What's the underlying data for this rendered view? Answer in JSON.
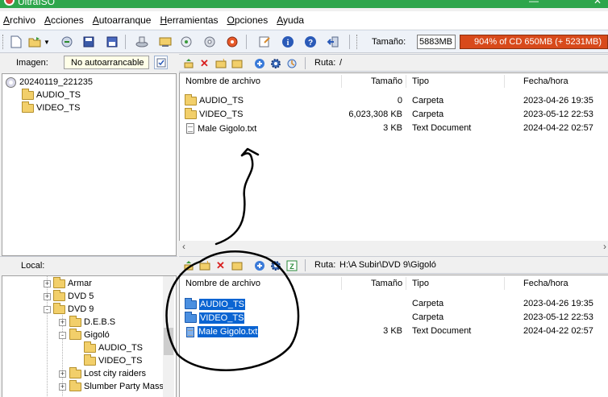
{
  "app": {
    "title": "UltraISO"
  },
  "menu": [
    "Archivo",
    "Acciones",
    "Autoarranque",
    "Herramientas",
    "Opciones",
    "Ayuda"
  ],
  "toolbar": {
    "size_label": "Tamaño:",
    "size_value": "5883MB",
    "capacity_text": "904% of CD 650MB (+ 5231MB)",
    "capacity_percent": 904
  },
  "image_pane": {
    "label": "Imagen:",
    "boot_status": "No autoarrancable",
    "tree": [
      {
        "label": "20240119_221235",
        "type": "disc"
      },
      {
        "label": "AUDIO_TS",
        "type": "folder"
      },
      {
        "label": "VIDEO_TS",
        "type": "folder"
      }
    ]
  },
  "upper_files": {
    "path_label": "Ruta:",
    "path": "/",
    "columns": [
      "Nombre de archivo",
      "Tamaño",
      "Tipo",
      "Fecha/hora"
    ],
    "rows": [
      {
        "name": "AUDIO_TS",
        "size": "0",
        "type": "Carpeta",
        "date": "2023-04-26 19:35",
        "icon": "folder"
      },
      {
        "name": "VIDEO_TS",
        "size": "6,023,308 KB",
        "type": "Carpeta",
        "date": "2023-05-12 22:53",
        "icon": "folder"
      },
      {
        "name": "Male Gigolo.txt",
        "size": "3 KB",
        "type": "Text Document",
        "date": "2024-04-22 02:57",
        "icon": "doc"
      }
    ]
  },
  "local_pane": {
    "label": "Local:",
    "tree": [
      {
        "label": "Armar",
        "expander": "+"
      },
      {
        "label": "DVD 5",
        "expander": "+"
      },
      {
        "label": "DVD 9",
        "expander": "-"
      },
      {
        "label": "D.E.B.S",
        "expander": "+"
      },
      {
        "label": "Gigoló",
        "expander": "-"
      },
      {
        "label": "AUDIO_TS",
        "expander": ""
      },
      {
        "label": "VIDEO_TS",
        "expander": ""
      },
      {
        "label": "Lost city raiders",
        "expander": "+"
      },
      {
        "label": "Slumber Party Massa",
        "expander": "+"
      }
    ]
  },
  "lower_files": {
    "path_label": "Ruta:",
    "path": "H:\\A Subir\\DVD 9\\Gigoló",
    "columns": [
      "Nombre de archivo",
      "Tamaño",
      "Tipo",
      "Fecha/hora"
    ],
    "rows": [
      {
        "name": "AUDIO_TS",
        "size": "",
        "type": "Carpeta",
        "date": "2023-04-26 19:35",
        "icon": "folder"
      },
      {
        "name": "VIDEO_TS",
        "size": "",
        "type": "Carpeta",
        "date": "2023-05-12 22:53",
        "icon": "folder"
      },
      {
        "name": "Male Gigolo.txt",
        "size": "3 KB",
        "type": "Text Document",
        "date": "2024-04-22 02:57",
        "icon": "doc"
      }
    ]
  },
  "colors": {
    "titlebar": "#2ea64c",
    "capacity_bar": "#d84a1b",
    "selection": "#0a64d2"
  }
}
